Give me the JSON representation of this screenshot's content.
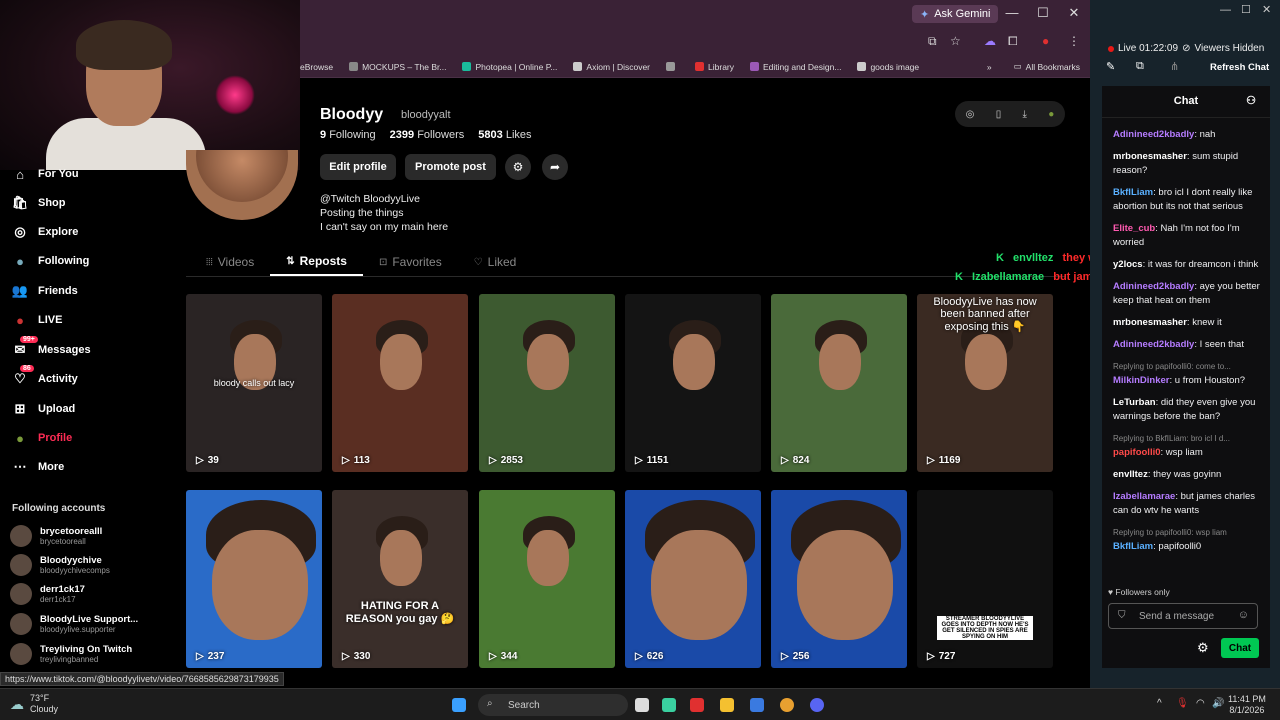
{
  "browser": {
    "gemini_label": "Ask Gemini",
    "minimize": "—",
    "maximize": "☐",
    "close": "✕",
    "bookmarks": [
      {
        "label": "eBrowse",
        "color": "#666"
      },
      {
        "label": "MOCKUPS – The Br...",
        "color": "#888"
      },
      {
        "label": "Photopea | Online P...",
        "color": "#1abc9c"
      },
      {
        "label": "Axiom | Discover",
        "color": "#ccc"
      },
      {
        "label": "",
        "color": "#999"
      },
      {
        "label": "Library",
        "color": "#e03030"
      },
      {
        "label": "Editing and Design...",
        "color": "#9b59b6"
      },
      {
        "label": "goods image",
        "color": "#ccc"
      }
    ],
    "all_bookmarks": "All Bookmarks",
    "chevron": "»"
  },
  "sidebar": {
    "items": [
      {
        "label": "For You",
        "icon": "home-icon",
        "glyph": "⌂"
      },
      {
        "label": "Shop",
        "icon": "shop-icon",
        "glyph": "🛍"
      },
      {
        "label": "Explore",
        "icon": "compass-icon",
        "glyph": "◎"
      },
      {
        "label": "Following",
        "icon": "following-avatar-icon",
        "glyph": "●"
      },
      {
        "label": "Friends",
        "icon": "friends-icon",
        "glyph": "👥"
      },
      {
        "label": "LIVE",
        "icon": "live-icon",
        "glyph": "●"
      },
      {
        "label": "Messages",
        "icon": "messages-icon",
        "glyph": "✉",
        "badge": "99+"
      },
      {
        "label": "Activity",
        "icon": "activity-icon",
        "glyph": "♡",
        "badge": "86"
      },
      {
        "label": "Upload",
        "icon": "upload-icon",
        "glyph": "⊞"
      },
      {
        "label": "Profile",
        "icon": "profile-avatar-icon",
        "glyph": "●"
      },
      {
        "label": "More",
        "icon": "more-icon",
        "glyph": "⋯"
      }
    ],
    "following_title": "Following accounts",
    "accounts": [
      {
        "name": "brycetoorealll",
        "handle": "brycetooreall"
      },
      {
        "name": "Bloodyychive",
        "handle": "bloodyychivecomps"
      },
      {
        "name": "derr1ck17",
        "handle": "derr1ck17"
      },
      {
        "name": "BloodyLive Support...",
        "handle": "bloodyylive.supporter"
      },
      {
        "name": "Treyliving On Twitch",
        "handle": "treylivingbanned"
      }
    ],
    "status_url": "https://www.tiktok.com/@bloodyylivetv/video/7668585629873179935"
  },
  "profile": {
    "name": "Bloodyy",
    "handle": "bloodyyalt",
    "following_count": "9",
    "following_label": "Following",
    "followers_count": "2399",
    "followers_label": "Followers",
    "likes_count": "5803",
    "likes_label": "Likes",
    "edit_label": "Edit profile",
    "promote_label": "Promote post",
    "bio": [
      "@Twitch BloodyyLive",
      "Posting the things",
      "I can't say on my main here"
    ]
  },
  "tabs": [
    {
      "label": "Videos",
      "icon": "grid-icon",
      "glyph": "⦙⦙⦙"
    },
    {
      "label": "Reposts",
      "icon": "repost-icon",
      "glyph": "⇅"
    },
    {
      "label": "Favorites",
      "icon": "bookmark-icon",
      "glyph": "⊡"
    },
    {
      "label": "Liked",
      "icon": "heart-icon",
      "glyph": "♡"
    }
  ],
  "videos": [
    {
      "views": "39",
      "caption": "bloody calls out lacy",
      "bg": "#2a2424"
    },
    {
      "views": "113",
      "caption": "",
      "bg": "#5a2e22"
    },
    {
      "views": "2853",
      "caption": "",
      "bg": "#3d5a30"
    },
    {
      "views": "1151",
      "caption": "",
      "bg": "#141414"
    },
    {
      "views": "824",
      "caption": "",
      "bg": "#4a6a3a"
    },
    {
      "views": "1169",
      "caption": "BloodyyLive has now been banned after exposing this 👇",
      "bg": "#3a2a22"
    },
    {
      "views": "237",
      "caption": "",
      "bg": "#2a6bc8"
    },
    {
      "views": "330",
      "caption": "HATING FOR A REASON you gay 🤔",
      "bg": "#3a2e2a"
    },
    {
      "views": "344",
      "caption": "",
      "bg": "#4a7a32"
    },
    {
      "views": "626",
      "caption": "",
      "bg": "#1a4aa8"
    },
    {
      "views": "256",
      "caption": "",
      "bg": "#1a4aa8"
    },
    {
      "views": "727",
      "caption": "STREAMER BLOODYYLIVE GOES INTO DEPTH NOW HE'S GET SILENCED IN SPIES ARE SPYING ON HIM",
      "bg": "#101010"
    }
  ],
  "twitch": {
    "live_time": "Live 01:22:09",
    "viewers": "Viewers Hidden",
    "refresh": "Refresh Chat",
    "chat_title": "Chat",
    "messages": [
      {
        "user": "Adinineed2kbadly",
        "color": "#b57cff",
        "text": "nah"
      },
      {
        "user": "mrbonesmasher",
        "color": "#ffffff",
        "text": "sum stupid reason?"
      },
      {
        "user": "BkfILiam",
        "color": "#5ab0ff",
        "text": "bro icl I dont really like abortion but its not that serious"
      },
      {
        "user": "Elite_cub",
        "color": "#ff5ab0",
        "text": "Nah I'm not foo I'm worried"
      },
      {
        "user": "y2locs",
        "color": "#ffffff",
        "text": "it was for dreamcon i think"
      },
      {
        "user": "Adinineed2kbadly",
        "color": "#b57cff",
        "text": "aye you better keep that heat on them"
      },
      {
        "user": "mrbonesmasher",
        "color": "#ffffff",
        "text": "knew it"
      },
      {
        "user": "Adinineed2kbadly",
        "color": "#b57cff",
        "text": "I seen that"
      },
      {
        "reply": "Replying to papifoolli0: come to...",
        "user": "MilkinDinker",
        "color": "#b57cff",
        "text": "u from Houston?"
      },
      {
        "user": "LeTurban",
        "color": "#ffffff",
        "text": "did they even give you warnings before the ban?"
      },
      {
        "reply": "Replying to BkfILiam: bro icl I d...",
        "user": "papifoolli0",
        "color": "#ff4a4a",
        "text": "wsp liam"
      },
      {
        "user": "envlltez",
        "color": "#ffffff",
        "text": "they was goyinn"
      },
      {
        "user": "Izabellamarae",
        "color": "#b57cff",
        "text": "but james charles can do wtv he wants"
      },
      {
        "reply": "Replying to papifoolli0: wsp liam",
        "user": "BkfILiam",
        "color": "#5ab0ff",
        "text": "papifoolli0"
      }
    ],
    "followers_only": "Followers only",
    "send_placeholder": "Send a message",
    "chat_button": "Chat"
  },
  "overlay": [
    {
      "user": "envlltez",
      "text": "they was goyinn"
    },
    {
      "user": "Izabellamarae",
      "text": "but james charles can do wtv he wants"
    }
  ],
  "taskbar": {
    "temp": "73°F",
    "weather": "Cloudy",
    "search": "Search",
    "time": "11:41 PM",
    "date": "8/1/2026"
  }
}
